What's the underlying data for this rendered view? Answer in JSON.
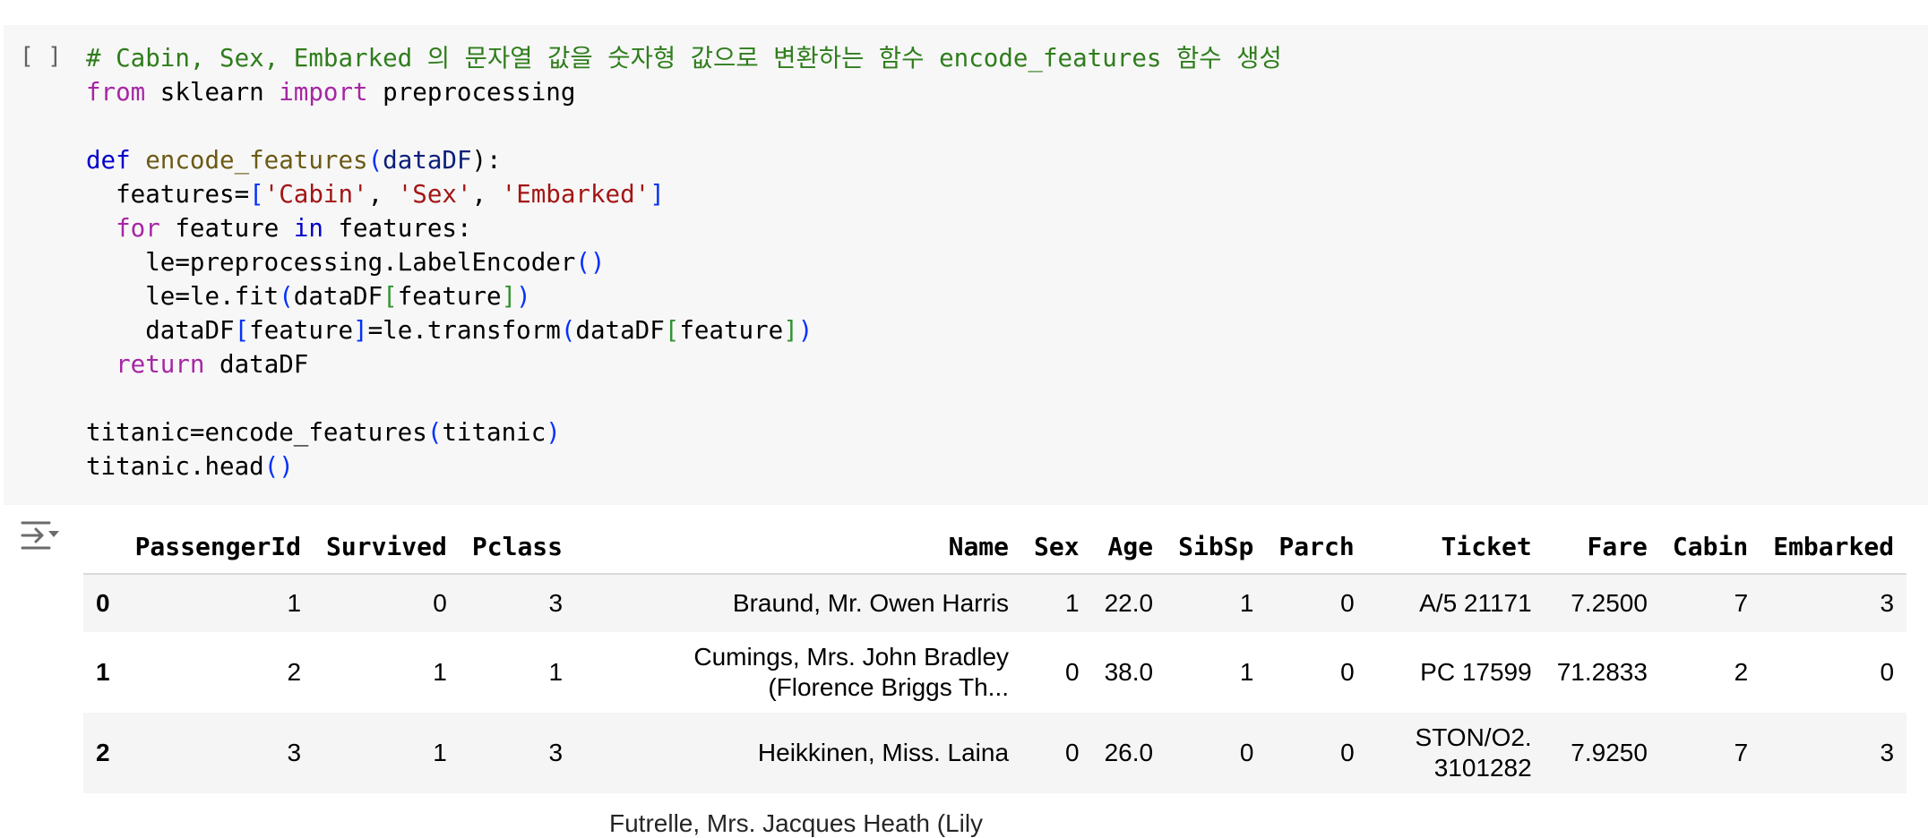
{
  "code_cell": {
    "run_indicator": "[ ]",
    "lines": [
      [
        {
          "t": "# Cabin, Sex, Embarked 의 문자열 값을 숫자형 값으로 변환하는 함수 encode_features 함수 생성",
          "c": "comment"
        }
      ],
      [
        {
          "t": "from",
          "c": "kw"
        },
        {
          "t": " sklearn ",
          "c": ""
        },
        {
          "t": "import",
          "c": "kw"
        },
        {
          "t": " preprocessing",
          "c": ""
        }
      ],
      [],
      [
        {
          "t": "def",
          "c": "def"
        },
        {
          "t": " ",
          "c": ""
        },
        {
          "t": "encode_features",
          "c": "fn"
        },
        {
          "t": "(",
          "c": "br1"
        },
        {
          "t": "dataDF",
          "c": "param"
        },
        {
          "t": "):",
          "c": ""
        }
      ],
      [
        {
          "t": "  features=",
          "c": ""
        },
        {
          "t": "[",
          "c": "br1"
        },
        {
          "t": "'Cabin'",
          "c": "str"
        },
        {
          "t": ", ",
          "c": ""
        },
        {
          "t": "'Sex'",
          "c": "str"
        },
        {
          "t": ", ",
          "c": ""
        },
        {
          "t": "'Embarked'",
          "c": "str"
        },
        {
          "t": "]",
          "c": "br1"
        }
      ],
      [
        {
          "t": "  ",
          "c": ""
        },
        {
          "t": "for",
          "c": "kw"
        },
        {
          "t": " feature ",
          "c": ""
        },
        {
          "t": "in",
          "c": "in"
        },
        {
          "t": " features:",
          "c": ""
        }
      ],
      [
        {
          "t": "    le=preprocessing.LabelEncoder",
          "c": ""
        },
        {
          "t": "()",
          "c": "br1"
        }
      ],
      [
        {
          "t": "    le=le.fit",
          "c": ""
        },
        {
          "t": "(",
          "c": "br1"
        },
        {
          "t": "dataDF",
          "c": ""
        },
        {
          "t": "[",
          "c": "br2"
        },
        {
          "t": "feature",
          "c": ""
        },
        {
          "t": "]",
          "c": "br2"
        },
        {
          "t": ")",
          "c": "br1"
        }
      ],
      [
        {
          "t": "    dataDF",
          "c": ""
        },
        {
          "t": "[",
          "c": "br1"
        },
        {
          "t": "feature",
          "c": ""
        },
        {
          "t": "]",
          "c": "br1"
        },
        {
          "t": "=le.transform",
          "c": ""
        },
        {
          "t": "(",
          "c": "br1"
        },
        {
          "t": "dataDF",
          "c": ""
        },
        {
          "t": "[",
          "c": "br2"
        },
        {
          "t": "feature",
          "c": ""
        },
        {
          "t": "]",
          "c": "br2"
        },
        {
          "t": ")",
          "c": "br1"
        }
      ],
      [
        {
          "t": "  ",
          "c": ""
        },
        {
          "t": "return",
          "c": "kw"
        },
        {
          "t": " dataDF",
          "c": ""
        }
      ],
      [],
      [
        {
          "t": "titanic=encode_features",
          "c": ""
        },
        {
          "t": "(",
          "c": "br1"
        },
        {
          "t": "titanic",
          "c": ""
        },
        {
          "t": ")",
          "c": "br1"
        }
      ],
      [
        {
          "t": "titanic.head",
          "c": ""
        },
        {
          "t": "()",
          "c": "br1"
        }
      ]
    ]
  },
  "output": {
    "icon": "output-toggle-icon",
    "columns": [
      "",
      "PassengerId",
      "Survived",
      "Pclass",
      "Name",
      "Sex",
      "Age",
      "SibSp",
      "Parch",
      "Ticket",
      "Fare",
      "Cabin",
      "Embarked"
    ],
    "rows": [
      [
        "0",
        "1",
        "0",
        "3",
        "Braund, Mr. Owen Harris",
        "1",
        "22.0",
        "1",
        "0",
        "A/5 21171",
        "7.2500",
        "7",
        "3"
      ],
      [
        "1",
        "2",
        "1",
        "1",
        "Cumings, Mrs. John Bradley (Florence Briggs Th...",
        "0",
        "38.0",
        "1",
        "0",
        "PC 17599",
        "71.2833",
        "2",
        "0"
      ],
      [
        "2",
        "3",
        "1",
        "3",
        "Heikkinen, Miss. Laina",
        "0",
        "26.0",
        "0",
        "0",
        "STON/O2. 3101282",
        "7.9250",
        "7",
        "3"
      ]
    ],
    "partial_row_text": "Futrelle, Mrs. Jacques Heath (Lily"
  }
}
